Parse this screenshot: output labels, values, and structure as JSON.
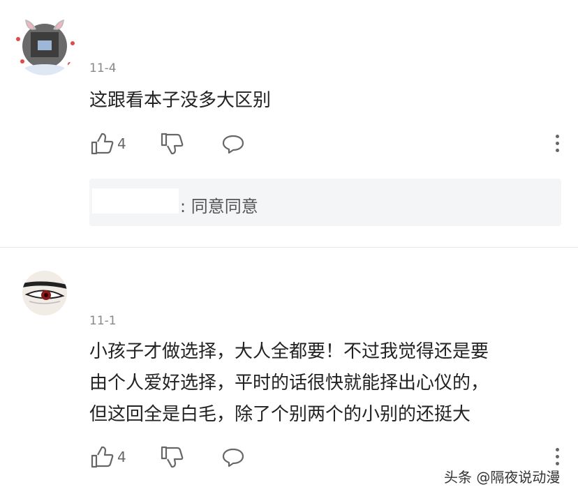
{
  "comments": [
    {
      "avatar_icon": "bunny-ears-photo-avatar-icon",
      "date": "11-4",
      "text": "这跟看本子没多大区别",
      "likes": "4",
      "reply": {
        "text": ": 同意同意"
      }
    },
    {
      "avatar_icon": "anime-eye-avatar-icon",
      "date": "11-1",
      "text_lines": [
        "小孩子才做选择，大人全都要！不过我觉得还是要",
        "由个人爱好选择，平时的话很快就能择出心仪的，",
        "但这回全是白毛，除了个别两个的小别的还挺大"
      ],
      "likes": "4"
    }
  ],
  "watermark": "头条 @隔夜说动漫",
  "colors": {
    "text": "#222222",
    "muted": "#888888",
    "reply_bg": "#f4f5f6"
  }
}
